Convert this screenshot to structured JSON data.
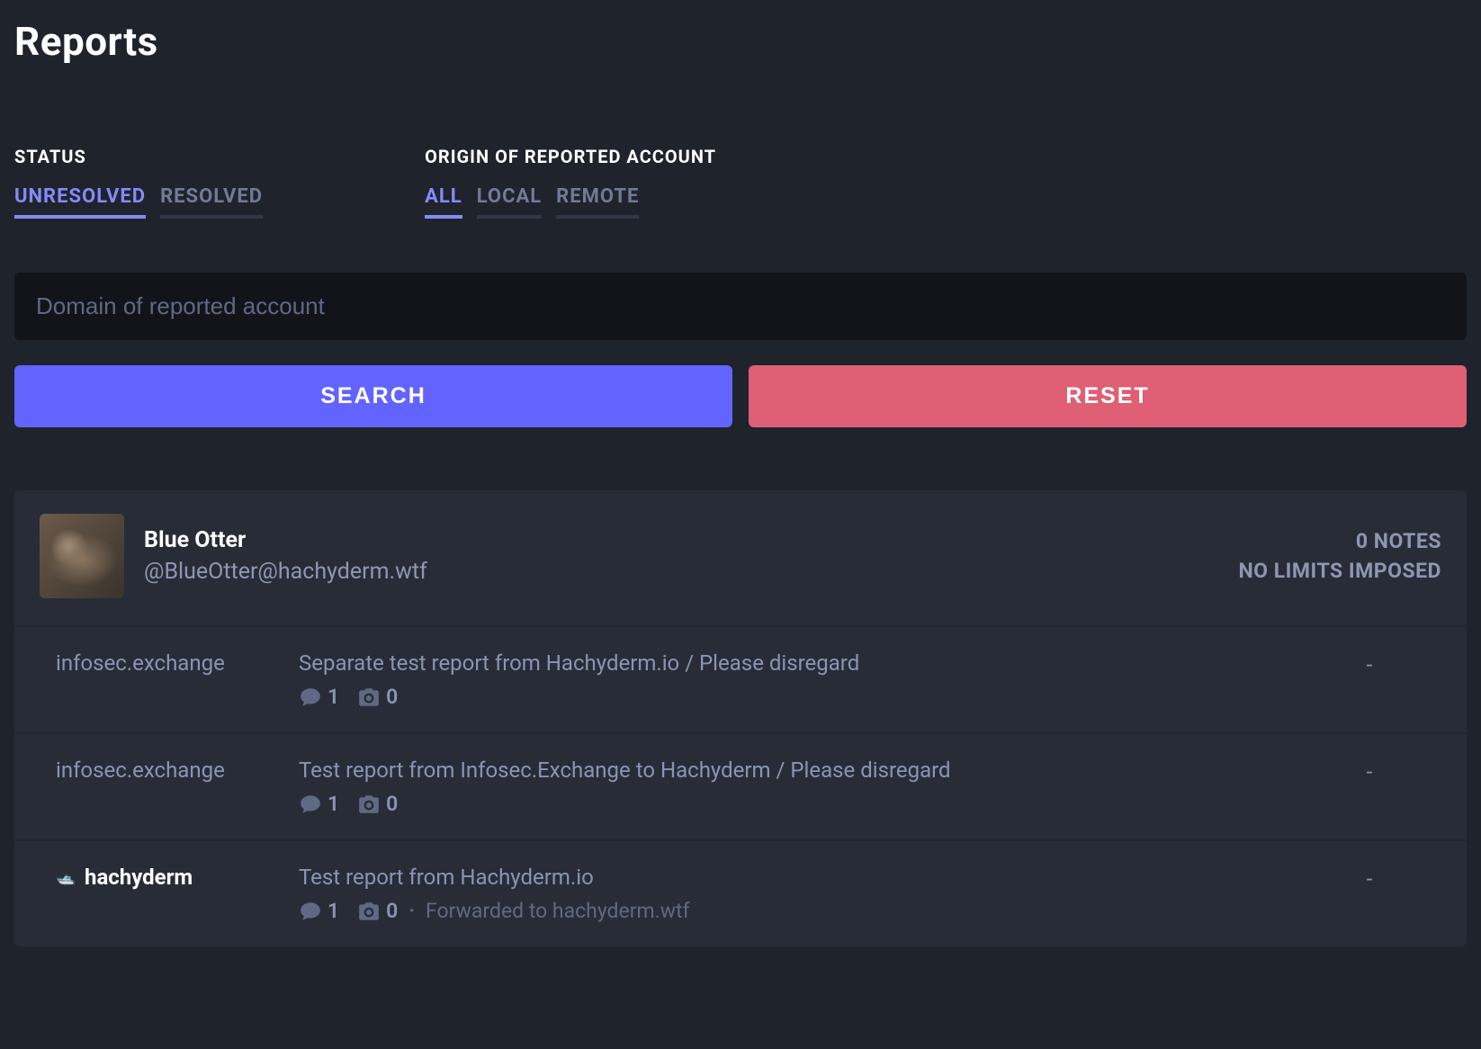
{
  "page": {
    "title": "Reports"
  },
  "filters": {
    "status": {
      "label": "STATUS",
      "tabs": [
        {
          "id": "unresolved",
          "label": "UNRESOLVED",
          "selected": true
        },
        {
          "id": "resolved",
          "label": "RESOLVED",
          "selected": false
        }
      ]
    },
    "origin": {
      "label": "ORIGIN OF REPORTED ACCOUNT",
      "tabs": [
        {
          "id": "all",
          "label": "ALL",
          "selected": true
        },
        {
          "id": "local",
          "label": "LOCAL",
          "selected": false
        },
        {
          "id": "remote",
          "label": "REMOTE",
          "selected": false
        }
      ]
    }
  },
  "search": {
    "placeholder": "Domain of reported account",
    "value": "",
    "search_button": "SEARCH",
    "reset_button": "RESET"
  },
  "report_card": {
    "account": {
      "display_name": "Blue Otter",
      "handle": "@BlueOtter@hachyderm.wtf"
    },
    "summary": {
      "notes": "0 NOTES",
      "limits": "NO LIMITS IMPOSED"
    },
    "rows": [
      {
        "source": "infosec.exchange",
        "source_bold": false,
        "source_has_avatar": false,
        "text": "Separate test report from Hachyderm.io / Please disregard",
        "comments": "1",
        "media": "0",
        "forwarded": "",
        "right": "-"
      },
      {
        "source": "infosec.exchange",
        "source_bold": false,
        "source_has_avatar": false,
        "text": "Test report from Infosec.Exchange to Hachyderm / Please disregard",
        "comments": "1",
        "media": "0",
        "forwarded": "",
        "right": "-"
      },
      {
        "source": "hachyderm",
        "source_bold": true,
        "source_has_avatar": true,
        "text": "Test report from Hachyderm.io",
        "comments": "1",
        "media": "0",
        "forwarded": "Forwarded to hachyderm.wtf",
        "right": "-"
      }
    ]
  }
}
